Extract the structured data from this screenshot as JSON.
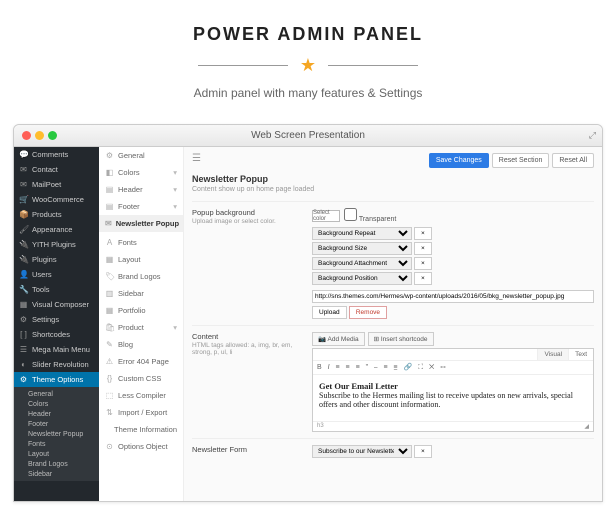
{
  "hero": {
    "title": "POWER ADMIN PANEL",
    "subtitle": "Admin panel with many features & Settings"
  },
  "window": {
    "title": "Web Screen Presentation"
  },
  "wp_menu": {
    "items": [
      {
        "icon": "💬",
        "label": "Comments"
      },
      {
        "icon": "✉",
        "label": "Contact"
      },
      {
        "icon": "✉",
        "label": "MailPoet"
      },
      {
        "icon": "🛒",
        "label": "WooCommerce"
      },
      {
        "icon": "📦",
        "label": "Products"
      },
      {
        "icon": "🖌",
        "label": "Appearance"
      },
      {
        "icon": "🔌",
        "label": "YITH Plugins"
      },
      {
        "icon": "🔌",
        "label": "Plugins"
      },
      {
        "icon": "👤",
        "label": "Users"
      },
      {
        "icon": "🔧",
        "label": "Tools"
      },
      {
        "icon": "▦",
        "label": "Visual Composer"
      },
      {
        "icon": "⚙",
        "label": "Settings"
      },
      {
        "icon": "[ ]",
        "label": "Shortcodes"
      },
      {
        "icon": "☰",
        "label": "Mega Main Menu"
      },
      {
        "icon": "◐",
        "label": "Slider Revolution"
      },
      {
        "icon": "⚙",
        "label": "Theme Options"
      }
    ],
    "sub": [
      "General",
      "Colors",
      "Header",
      "Footer",
      "Newsletter Popup",
      "Fonts",
      "Layout",
      "Brand Logos",
      "Sidebar"
    ]
  },
  "opt_menu": [
    {
      "icon": "⚙",
      "label": "General"
    },
    {
      "icon": "◧",
      "label": "Colors",
      "caret": "▾"
    },
    {
      "icon": "▤",
      "label": "Header",
      "caret": "▾"
    },
    {
      "icon": "▤",
      "label": "Footer",
      "caret": "▾"
    },
    {
      "icon": "✉",
      "label": "Newsletter Popup",
      "sel": true
    },
    {
      "icon": "A",
      "label": "Fonts"
    },
    {
      "icon": "▦",
      "label": "Layout"
    },
    {
      "icon": "🏷",
      "label": "Brand Logos"
    },
    {
      "icon": "▥",
      "label": "Sidebar"
    },
    {
      "icon": "▦",
      "label": "Portfolio"
    },
    {
      "icon": "🛍",
      "label": "Product",
      "caret": "▾"
    },
    {
      "icon": "✎",
      "label": "Blog"
    },
    {
      "icon": "⚠",
      "label": "Error 404 Page"
    },
    {
      "icon": "{}",
      "label": "Custom CSS"
    },
    {
      "icon": "⬚",
      "label": "Less Compiler"
    },
    {
      "icon": "⇅",
      "label": "Import / Export"
    },
    {
      "icon": "",
      "label": "Theme Information"
    },
    {
      "icon": "⊙",
      "label": "Options Object"
    }
  ],
  "toolbar": {
    "save": "Save Changes",
    "reset_section": "Reset Section",
    "reset_all": "Reset All"
  },
  "sections": {
    "popup": {
      "title": "Newsletter Popup",
      "desc": "Content show up on home page loaded"
    },
    "bg": {
      "title": "Popup background",
      "desc": "Upload image or select color.",
      "swatch": "Select color",
      "transparent": "Transparent",
      "selects": [
        "Background Repeat",
        "Background Size",
        "Background Attachment",
        "Background Position"
      ],
      "url": "http://sns.themes.com/Hermes/wp-content/uploads/2016/05/bkg_newsletter_popup.jpg",
      "upload": "Upload",
      "remove": "Remove"
    },
    "content": {
      "title": "Content",
      "desc": "HTML tags allowed: a, img, br, em, strong, p, ul, li",
      "add_media": "📷 Add Media",
      "shortcode": "⊞ Insert shortcode",
      "tabs": {
        "visual": "Visual",
        "text": "Text"
      },
      "heading": "Get Our Email Letter",
      "body": "Subscribe to the Hermes mailing list to receive updates on new arrivals, special offers and other discount information.",
      "path": "h3"
    },
    "form": {
      "title": "Newsletter Form",
      "value": "Subscribe to our Newsletter"
    }
  }
}
